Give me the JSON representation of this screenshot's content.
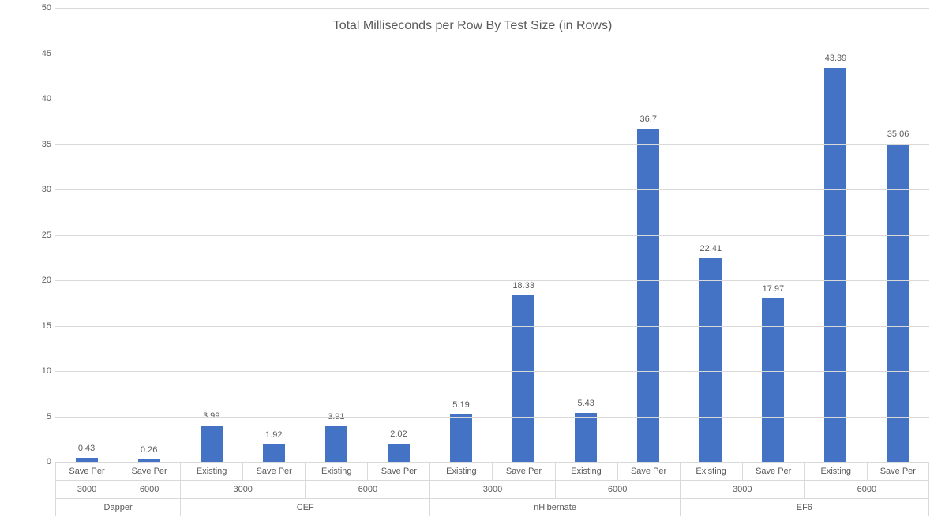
{
  "chart_data": {
    "type": "bar",
    "title": "Total Milliseconds per Row By Test Size (in Rows)",
    "xlabel": "",
    "ylabel": "",
    "ylim": [
      0,
      50
    ],
    "y_ticks": [
      0,
      5,
      10,
      15,
      20,
      25,
      30,
      35,
      40,
      45,
      50
    ],
    "level1_labels": [
      "Save Per",
      "Save Per",
      "Existing",
      "Save Per",
      "Existing",
      "Save Per",
      "Existing",
      "Save Per",
      "Existing",
      "Save Per",
      "Existing",
      "Save Per",
      "Existing",
      "Save Per"
    ],
    "level2_labels": [
      "3000",
      "6000",
      "3000",
      "6000",
      "3000",
      "6000",
      "3000",
      "6000"
    ],
    "level2_spans": [
      1,
      1,
      2,
      2,
      2,
      2,
      2,
      2
    ],
    "level3_labels": [
      "Dapper",
      "CEF",
      "nHibernate",
      "EF6"
    ],
    "level3_spans": [
      2,
      4,
      4,
      4
    ],
    "values": [
      0.43,
      0.26,
      3.99,
      1.92,
      3.91,
      2.02,
      5.19,
      18.33,
      5.43,
      36.7,
      22.41,
      17.97,
      43.39,
      35.06
    ],
    "value_labels": [
      "0.43",
      "0.26",
      "3.99",
      "1.92",
      "3.91",
      "2.02",
      "5.19",
      "18.33",
      "5.43",
      "36.7",
      "22.41",
      "17.97",
      "43.39",
      "35.06"
    ],
    "bar_color": "#4472c4"
  }
}
